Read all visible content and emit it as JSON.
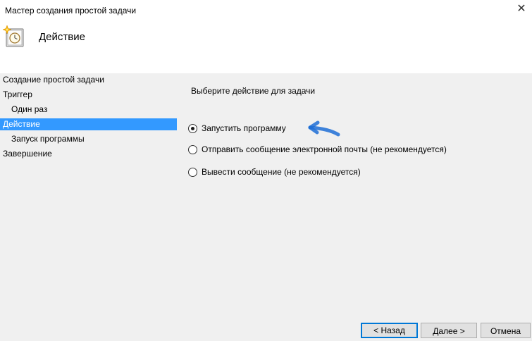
{
  "window": {
    "title": "Мастер создания простой задачи",
    "close_glyph": "✕"
  },
  "header": {
    "icon": "task-scheduler-icon",
    "heading": "Действие"
  },
  "steps": [
    {
      "label": "Создание простой задачи",
      "level": 0,
      "active": false
    },
    {
      "label": "Триггер",
      "level": 0,
      "active": false
    },
    {
      "label": "Один раз",
      "level": 1,
      "active": false
    },
    {
      "label": "Действие",
      "level": 0,
      "active": true
    },
    {
      "label": "Запуск программы",
      "level": 1,
      "active": false
    },
    {
      "label": "Завершение",
      "level": 0,
      "active": false
    }
  ],
  "content": {
    "prompt": "Выберите действие для задачи",
    "options": [
      {
        "label": "Запустить программу",
        "selected": true
      },
      {
        "label": "Отправить сообщение электронной почты (не рекомендуется)",
        "selected": false
      },
      {
        "label": "Вывести сообщение (не рекомендуется)",
        "selected": false
      }
    ]
  },
  "buttons": {
    "back": "< Назад",
    "next": "Далее >",
    "cancel": "Отмена"
  },
  "colors": {
    "selection": "#3399ff",
    "panel": "#f0f0f0",
    "annotation_arrow": "#1f6fd6"
  }
}
